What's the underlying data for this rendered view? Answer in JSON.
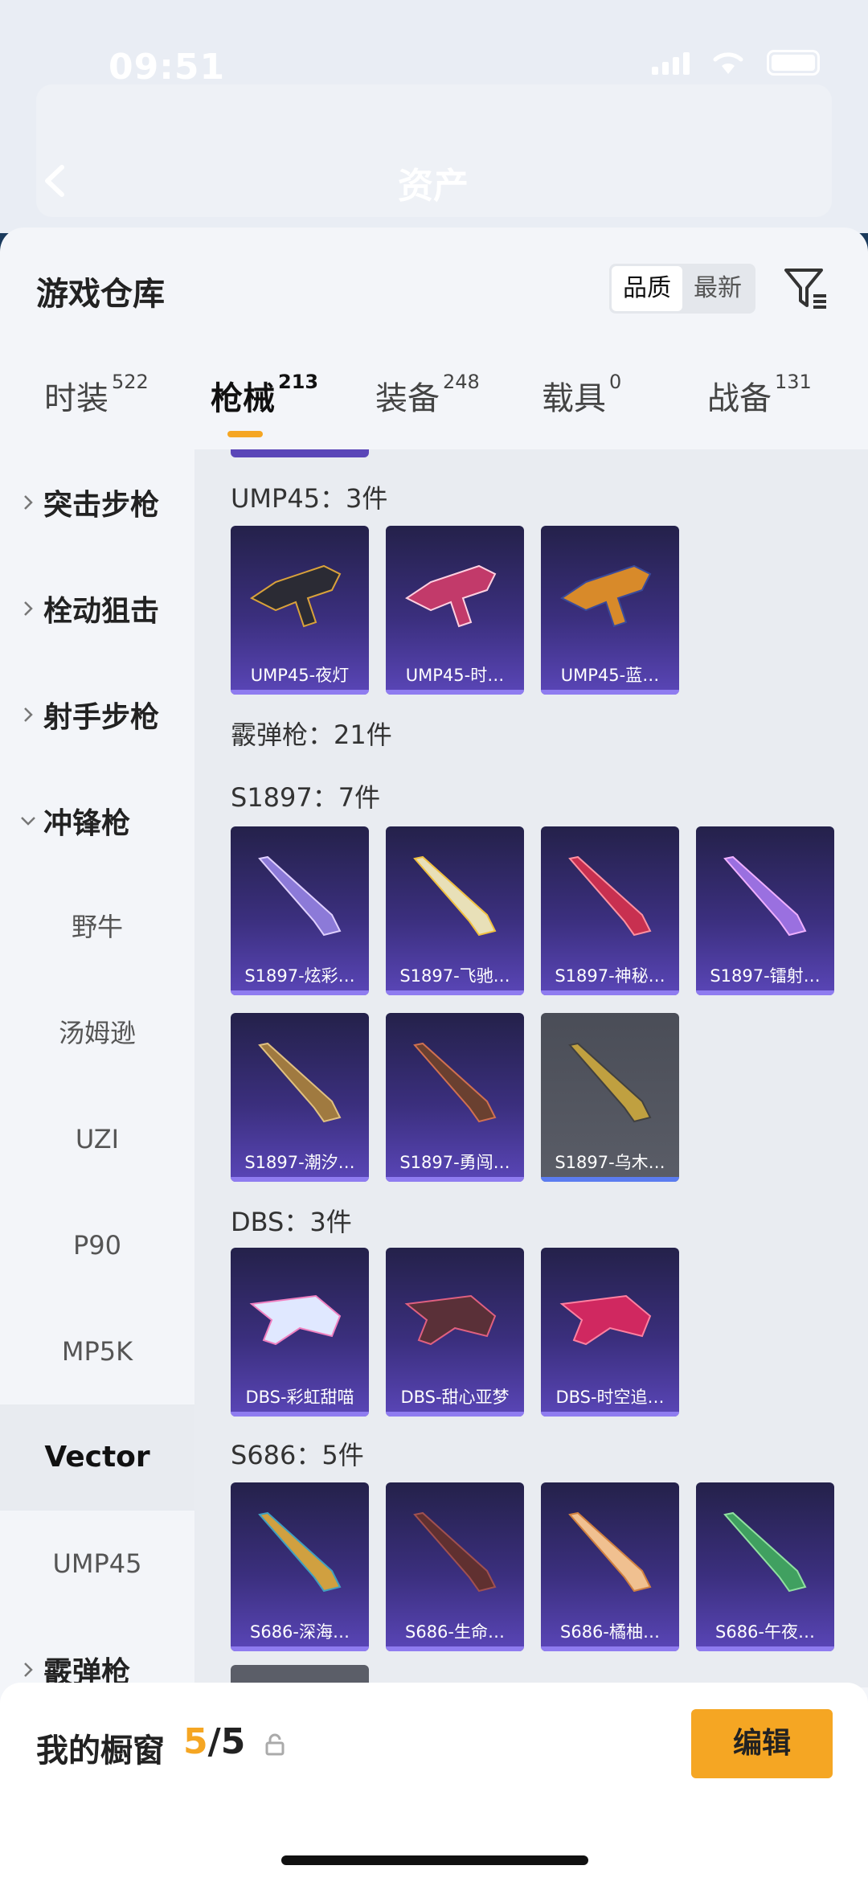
{
  "status_bar": {
    "time": "09:51"
  },
  "header": {
    "title": "资产"
  },
  "sheet": {
    "title": "游戏仓库",
    "sort": {
      "options": [
        "品质",
        "最新"
      ],
      "selected": "品质"
    }
  },
  "tabs": [
    {
      "label": "时装",
      "count": "522"
    },
    {
      "label": "枪械",
      "count": "213",
      "active": true
    },
    {
      "label": "装备",
      "count": "248"
    },
    {
      "label": "载具",
      "count": "0"
    },
    {
      "label": "战备",
      "count": "131"
    }
  ],
  "sidebar": {
    "categories": [
      "突击步枪",
      "栓动狙击",
      "射手步枪",
      "冲锋枪"
    ],
    "subitems": [
      "野牛",
      "汤姆逊",
      "UZI",
      "P90",
      "MP5K",
      "Vector",
      "UMP45"
    ],
    "active_sub": "Vector",
    "last_category": "霰弹枪"
  },
  "content": {
    "groups": [
      {
        "title": "UMP45：3件",
        "items": [
          "UMP45-夜灯",
          "UMP45-时…",
          "UMP45-蓝…"
        ]
      },
      {
        "title": "霰弹枪：21件"
      },
      {
        "title": "S1897：7件",
        "items": [
          "S1897-炫彩…",
          "S1897-飞驰…",
          "S1897-神秘…",
          "S1897-镭射…",
          "S1897-潮汐…",
          "S1897-勇闯…",
          "S1897-乌木…"
        ]
      },
      {
        "title": "DBS：3件",
        "items": [
          "DBS-彩虹甜喵",
          "DBS-甜心亚梦",
          "DBS-时空追…"
        ]
      },
      {
        "title": "S686：5件",
        "items": [
          "S686-深海…",
          "S686-生命…",
          "S686-橘柚…",
          "S686-午夜…"
        ]
      }
    ]
  },
  "bottom": {
    "label": "我的橱窗",
    "current": "5",
    "total": "/5",
    "edit": "编辑"
  },
  "colors": {
    "accent": "#f5a623",
    "card_purple": "#3b2f7e"
  }
}
